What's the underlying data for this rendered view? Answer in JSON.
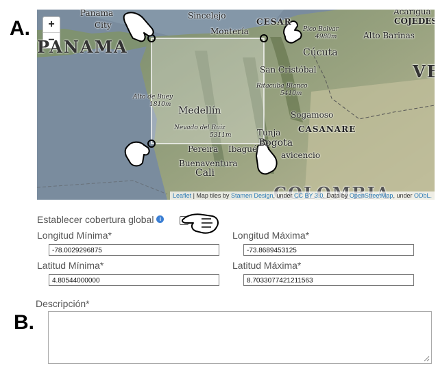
{
  "markers": {
    "a": "A.",
    "b": "B."
  },
  "map": {
    "zoom_in": "+",
    "zoom_out": "−",
    "labels": {
      "panama": "Panama",
      "city": "City",
      "panama_big": "PANAMA",
      "sincelejo": "Sincelejo",
      "monteria": "Montería",
      "cesar": "CESAR",
      "pico_bolivar": "Pico Bolvar",
      "pico_bolivar_elev": "4980m",
      "alto_barinas": "Alto Barinas",
      "acarigua": "Acarigua",
      "cojedes": "COJEDES",
      "cucuta": "Cúcuta",
      "san_cristobal": "San Cristóbal",
      "ve": "VE",
      "ritacuba": "Ritacuba Blanco",
      "ritacuba_elev": "5410m",
      "alto_de_buey": "Alto de Buey",
      "alto_de_buey_elev": "1810m",
      "medellin": "Medellín",
      "nevado": "Nevado del Ruiz",
      "nevado_elev": "5311m",
      "sogamoso": "Sogamoso",
      "casanare": "CASANARE",
      "tunja": "Tunja",
      "bogota": "Bogota",
      "villavicencio": "avicencio",
      "pereira": "Pereira",
      "ibague": "Ibagué",
      "buenaventura": "Buenaventura",
      "cali": "Cali",
      "colombia": "COLOMBIA"
    },
    "attribution": {
      "leaflet": "Leaflet",
      "text1": " | Map tiles by ",
      "stamen": "Stamen Design",
      "text2": ", under ",
      "ccby": "CC BY 3.0",
      "text3": ". Data by ",
      "osm": "OpenStreetMap",
      "text4": ", under ",
      "odbl": "ODbL."
    }
  },
  "form": {
    "global_coverage_label": "Establecer cobertura global",
    "info_icon": "i",
    "lon_min_label": "Longitud Mínima*",
    "lon_min_value": "-78.0029296875",
    "lon_max_label": "Longitud Máxima*",
    "lon_max_value": "-73.8689453125",
    "lat_min_label": "Latitud Mínima*",
    "lat_min_value": "4.80544000000",
    "lat_max_label": "Latitud Máxima*",
    "lat_max_value": "8.7033077421211563",
    "description_label": "Descripción*",
    "description_value": ""
  }
}
